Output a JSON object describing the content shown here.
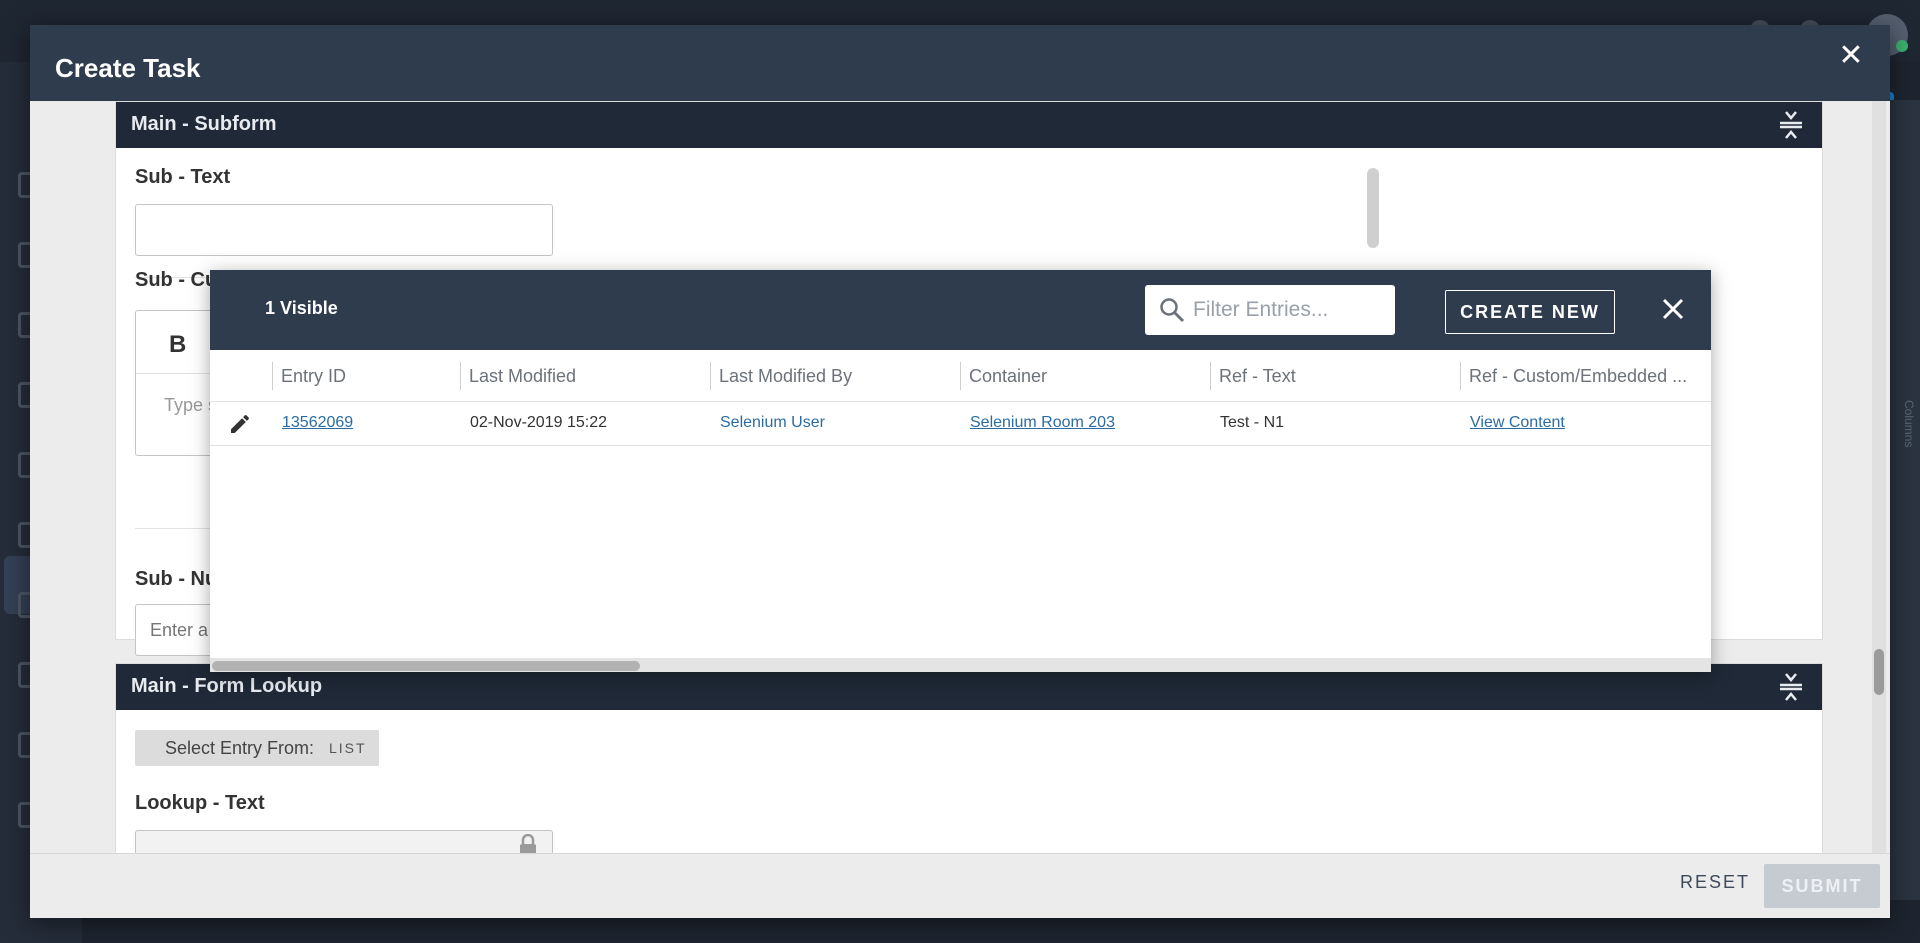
{
  "modal": {
    "title": "Create Task",
    "close_glyph": "✕",
    "footer": {
      "reset_label": "RESET",
      "submit_label": "SUBMIT"
    }
  },
  "subform": {
    "title": "Main - Subform",
    "fields": [
      {
        "label": "Sub - Text"
      },
      {
        "label": "Sub - Cu"
      },
      {
        "label": "Sub - Nu",
        "placeholder": "Enter a"
      }
    ],
    "editor": {
      "bold_glyph": "B",
      "placeholder": "Type s"
    }
  },
  "form_lookup": {
    "title": "Main - Form Lookup",
    "select_entry_label": "Select Entry From:",
    "select_entry_mode": "LIST",
    "lookup_text_label": "Lookup - Text"
  },
  "lookup_popup": {
    "visible_count": "1 Visible",
    "filter_placeholder": "Filter Entries...",
    "create_new_label": "CREATE NEW",
    "columns": [
      "Entry ID",
      "Last Modified",
      "Last Modified By",
      "Container",
      "Ref - Text",
      "Ref - Custom/Embedded ..."
    ],
    "rows": [
      {
        "entry_id": "13562069",
        "last_modified": "02-Nov-2019 15:22",
        "last_modified_by": "Selenium User",
        "container": "Selenium Room 203",
        "ref_text": "Test - N1",
        "ref_custom": "View Content"
      }
    ]
  },
  "background": {
    "columns_label": "Columns"
  },
  "colors": {
    "header_dark": "#2f3c4e",
    "section_header": "#1f2937",
    "link": "#2b6ca3",
    "submit_disabled": "#c6cbd2"
  }
}
